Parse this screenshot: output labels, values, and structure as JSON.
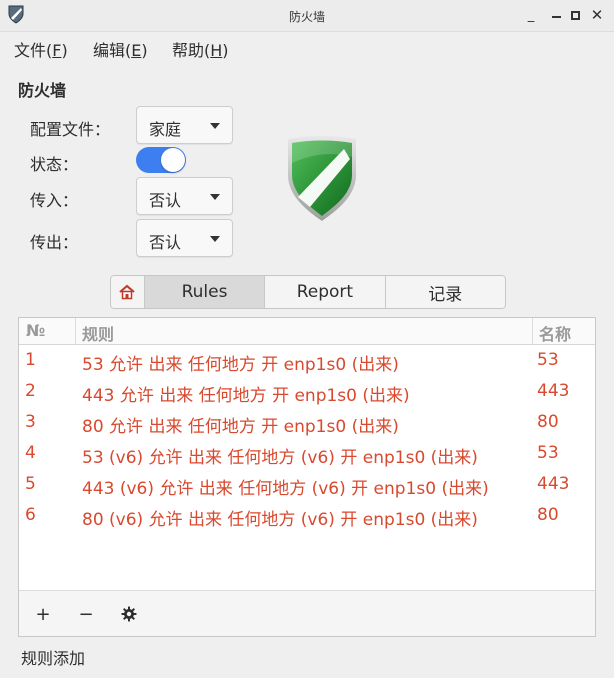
{
  "window": {
    "title": "防火墙",
    "controls": [
      "minimize-icon",
      "maximize-icon",
      "close-icon"
    ]
  },
  "menubar": {
    "items": [
      {
        "label": "文件(F)",
        "mnemonic": "F"
      },
      {
        "label": "编辑(E)",
        "mnemonic": "E"
      },
      {
        "label": "帮助(H)",
        "mnemonic": "H"
      }
    ]
  },
  "firewall": {
    "section_title": "防火墙",
    "profile_label": "配置文件：",
    "profile_value": "家庭",
    "status_label": "状态：",
    "status_enabled": true,
    "incoming_label": "传入：",
    "incoming_value": "否认",
    "outgoing_label": "传出：",
    "outgoing_value": "否认",
    "shield_icon": "shield-icon"
  },
  "tabs": {
    "home_icon": "home-icon",
    "items": [
      {
        "label": "Rules",
        "active": true
      },
      {
        "label": "Report",
        "active": false
      },
      {
        "label": "记录",
        "active": false
      }
    ]
  },
  "rules_table": {
    "columns": [
      "№",
      "规则",
      "名称"
    ],
    "rows": [
      {
        "no": "1",
        "rule": "53 允许 出来 任何地方 开 enp1s0 (出来)",
        "name": "53"
      },
      {
        "no": "2",
        "rule": "443 允许 出来 任何地方 开 enp1s0 (出来)",
        "name": "443"
      },
      {
        "no": "3",
        "rule": "80 允许 出来 任何地方 开 enp1s0 (出来)",
        "name": "80"
      },
      {
        "no": "4",
        "rule": "53 (v6) 允许 出来 任何地方 (v6) 开 enp1s0 (出来)",
        "name": "53"
      },
      {
        "no": "5",
        "rule": "443 (v6) 允许 出来 任何地方 (v6) 开 enp1s0 (出来)",
        "name": "443"
      },
      {
        "no": "6",
        "rule": "80 (v6) 允许 出来 任何地方 (v6) 开 enp1s0 (出来)",
        "name": "80"
      }
    ],
    "row_color": "#d9492e",
    "footer": {
      "add": "+",
      "remove": "−",
      "settings_icon": "gear-icon"
    }
  },
  "statusbar": {
    "text": "规则添加"
  },
  "colors": {
    "accent": "#3d7ff0",
    "shield_green": "#1e8a2e",
    "rule_text": "#d9492e"
  }
}
